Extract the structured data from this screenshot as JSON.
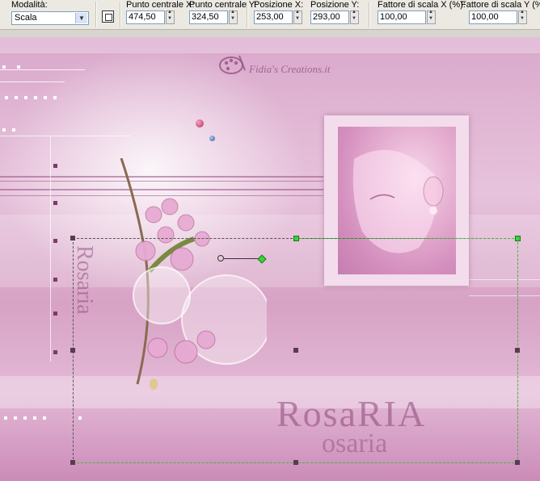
{
  "toolbar": {
    "mode_label": "Modalità:",
    "mode_value": "Scala",
    "center_x_label": "Punto centrale X:",
    "center_x_value": "474,50",
    "center_y_label": "Punto centrale Y:",
    "center_y_value": "324,50",
    "pos_x_label": "Posizione X:",
    "pos_x_value": "253,00",
    "pos_y_label": "Posizione Y:",
    "pos_y_value": "293,00",
    "scale_x_label": "Fattore di scala X (%):",
    "scale_x_value": "100,00",
    "scale_y_label": "Fattore di scala Y (%):",
    "scale_y_value": "100,00"
  },
  "canvas": {
    "logo_text": "Fidia's Creations.it",
    "signature_main": "RosaRIA",
    "signature_sub": "osaria",
    "side_text": "Rosaria",
    "colors": {
      "accent_pink": "#d7a2c5",
      "selection_green": "#3bd13b",
      "handle_dark": "#5a3a52"
    }
  }
}
